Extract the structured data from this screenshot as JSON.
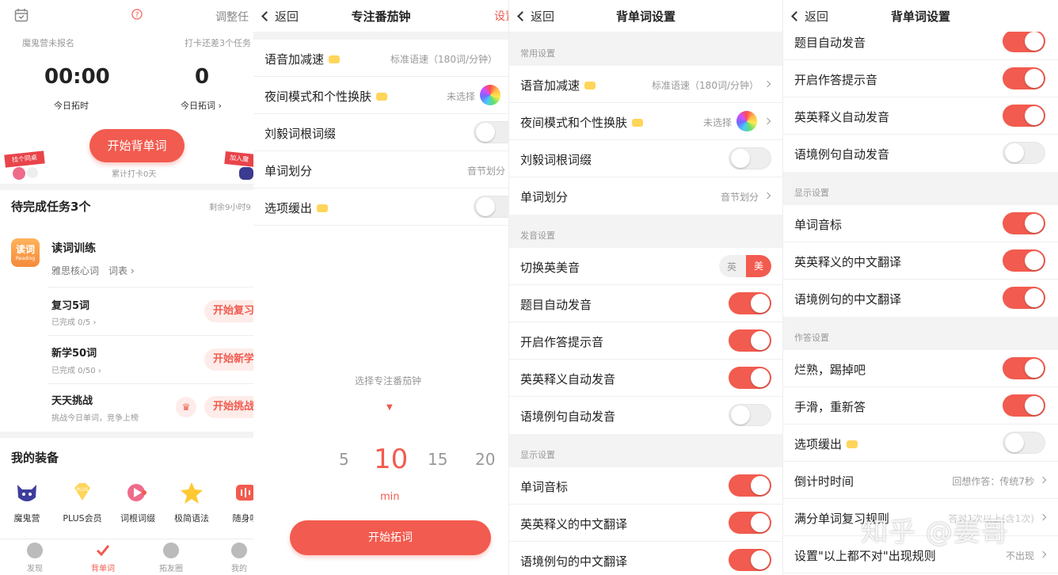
{
  "p1": {
    "calendar_icon": "calendar-icon",
    "help_icon": "help-icon",
    "adjust_task": "调整任",
    "camp_status": "魔鬼营未报名",
    "checkin_hint": "打卡还差3个任务",
    "time_value": "00:00",
    "time_label": "今日拓时",
    "words_value": "0",
    "words_label": "今日拓词",
    "start_button": "开始背单词",
    "total_checkin": "累计打卡0天",
    "banner_left": "找个同桌",
    "banner_right": "加入魔",
    "tasks_title": "待完成任务3个",
    "tasks_remaining": "剩余9小时9",
    "reading_badge_top": "读词",
    "reading_badge_bottom": "Reading",
    "reading_title": "读词训练",
    "reading_sub": "雅思核心词",
    "reading_link": "词表",
    "review_title": "复习5词",
    "review_progress": "已完成 0/5",
    "review_button": "开始复习",
    "new_title": "新学50词",
    "new_progress": "已完成 0/50",
    "new_button": "开始新学",
    "challenge_title": "天天挑战",
    "challenge_sub": "挑战今日单词，竞争上榜",
    "challenge_button": "开始挑战",
    "equip_title": "我的装备",
    "equip": [
      {
        "label": "魔鬼营",
        "icon": "devil-icon"
      },
      {
        "label": "PLUS会员",
        "icon": "plus-diamond-icon"
      },
      {
        "label": "词根词缀",
        "icon": "play-icon"
      },
      {
        "label": "极简语法",
        "icon": "star-icon"
      },
      {
        "label": "随身听",
        "icon": "audio-icon"
      }
    ],
    "tabs": [
      {
        "label": "发现",
        "icon": "compass-icon"
      },
      {
        "label": "背单词",
        "icon": "check-icon"
      },
      {
        "label": "拓友圈",
        "icon": "chat-icon"
      },
      {
        "label": "我的",
        "icon": "user-icon"
      }
    ]
  },
  "p2": {
    "back": "返回",
    "title": "专注番茄钟",
    "action": "设置",
    "rows": [
      {
        "label": "语音加减速",
        "value": "标准语速（180词/分钟）"
      },
      {
        "label": "夜间模式和个性换肤",
        "value": "未选择"
      },
      {
        "label": "刘毅词根词缀",
        "value": ""
      },
      {
        "label": "单词划分",
        "value": "音节划分"
      },
      {
        "label": "选项缓出",
        "value": ""
      }
    ],
    "picker_hint": "选择专注番茄钟",
    "picker_values": [
      "5",
      "10",
      "15",
      "20"
    ],
    "picker_unit": "min",
    "start_button": "开始拓词"
  },
  "p3": {
    "back": "返回",
    "title": "背单词设置",
    "section_common": "常用设置",
    "rows_common": [
      {
        "label": "语音加减速",
        "value": "标准语速（180词/分钟）"
      },
      {
        "label": "夜间模式和个性换肤",
        "value": "未选择"
      },
      {
        "label": "刘毅词根词缀",
        "value": ""
      },
      {
        "label": "单词划分",
        "value": "音节划分"
      }
    ],
    "section_sound": "发音设置",
    "accent_label": "切换英美音",
    "accent_uk": "英",
    "accent_us": "美",
    "rows_sound": [
      {
        "label": "题目自动发音"
      },
      {
        "label": "开启作答提示音"
      },
      {
        "label": "英英释义自动发音"
      },
      {
        "label": "语境例句自动发音"
      }
    ],
    "section_display": "显示设置",
    "rows_display": [
      {
        "label": "单词音标"
      },
      {
        "label": "英英释义的中文翻译"
      },
      {
        "label": "语境例句的中文翻译"
      }
    ]
  },
  "p4": {
    "back": "返回",
    "title": "背单词设置",
    "rows_top": [
      {
        "label": "题目自动发音"
      },
      {
        "label": "开启作答提示音"
      },
      {
        "label": "英英释义自动发音"
      },
      {
        "label": "语境例句自动发音"
      }
    ],
    "section_display": "显示设置",
    "rows_display": [
      {
        "label": "单词音标"
      },
      {
        "label": "英英释义的中文翻译"
      },
      {
        "label": "语境例句的中文翻译"
      }
    ],
    "section_answer": "作答设置",
    "rows_answer": [
      {
        "label": "烂熟，踢掉吧",
        "value": ""
      },
      {
        "label": "手滑，重新答",
        "value": ""
      },
      {
        "label": "选项缓出",
        "value": ""
      },
      {
        "label": "倒计时时间",
        "value": "回想作答：传统7秒"
      },
      {
        "label": "满分单词复习规则",
        "value": "答对1次以上(含1次)"
      },
      {
        "label": "设置\"以上都不对\"出现规则",
        "value": "不出现"
      }
    ],
    "watermark": "知乎 @姜哥"
  },
  "colors": {
    "accent": "#f25b4f",
    "vip": "#ffd55a",
    "section_bg": "#f3f3f3"
  }
}
